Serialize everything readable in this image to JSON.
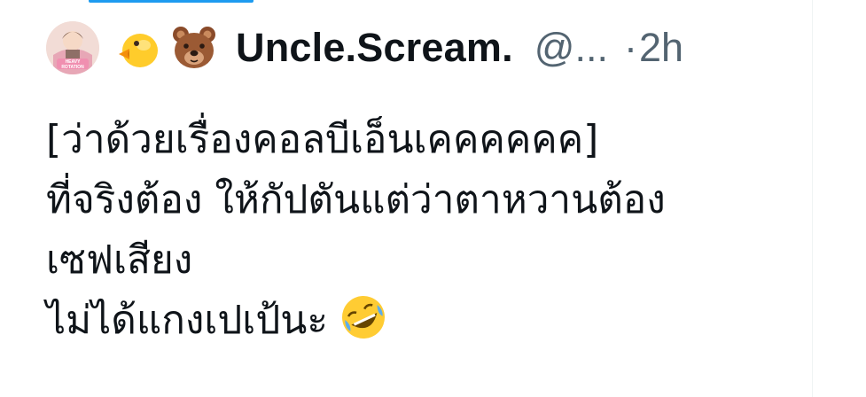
{
  "tweet": {
    "avatar_text": "HEAVY ROTATION",
    "header_emojis": [
      "chick-emoji",
      "bear-emoji"
    ],
    "display_name": "Uncle.Scream.",
    "handle": "@...",
    "separator": "·",
    "time": "2h",
    "lines": [
      "[ว่าด้วยเรื่องคอลบีเอ็นเคคคคคค]",
      "ที่จริงต้อง ให้กัปตันแต่ว่าตาหวานต้อง",
      "เซฟเสียง",
      "ไม่ได้แกงเปเป้นะ"
    ],
    "trailing_emoji": "rolling-on-floor-laughing-emoji"
  },
  "colors": {
    "accent": "#1d9bf0",
    "text": "#0f1419",
    "secondary": "#536471"
  }
}
